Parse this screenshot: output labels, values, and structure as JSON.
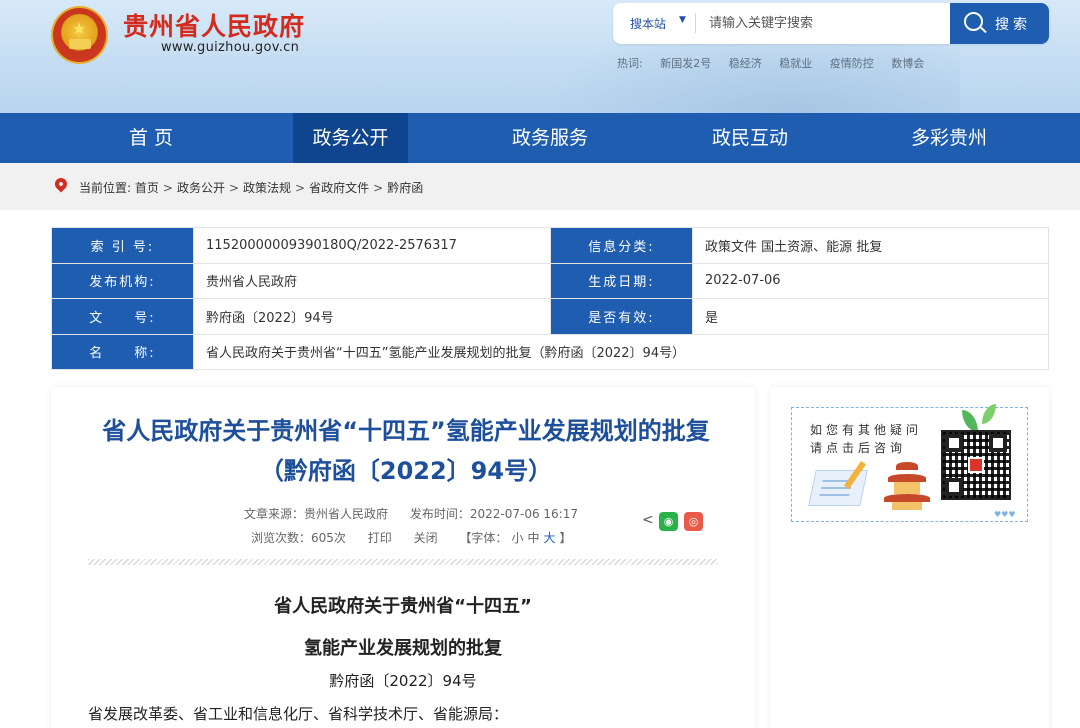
{
  "header": {
    "site_title": "贵州省人民政府",
    "site_url": "www.guizhou.gov.cn",
    "search": {
      "scope": "搜本站",
      "placeholder": "请输入关键字搜索",
      "button_label": "搜索"
    },
    "hot_label": "热词:",
    "hot_words": [
      "新国发2号",
      "稳经济",
      "稳就业",
      "疫情防控",
      "数博会"
    ]
  },
  "nav": {
    "items": [
      {
        "label": "首 页",
        "active": false
      },
      {
        "label": "政务公开",
        "active": true
      },
      {
        "label": "政务服务",
        "active": false
      },
      {
        "label": "政民互动",
        "active": false
      },
      {
        "label": "多彩贵州",
        "active": false
      }
    ]
  },
  "breadcrumb": {
    "prefix": "当前位置:",
    "items": [
      "首页",
      "政务公开",
      "政策法规",
      "省政府文件",
      "黔府函"
    ]
  },
  "info": {
    "index_label": "索 引 号:",
    "index_value": "11520000009390180Q/2022-2576317",
    "category_label": "信息分类:",
    "category_value": "政策文件    国土资源、能源    批复",
    "issuer_label": "发布机构:",
    "issuer_value": "贵州省人民政府",
    "date_label": "生成日期:",
    "date_value": "2022-07-06",
    "docno_label": "文　　号:",
    "docno_value": "黔府函〔2022〕94号",
    "valid_label": "是否有效:",
    "valid_value": "是",
    "name_label": "名　　称:",
    "name_value": "省人民政府关于贵州省“十四五”氢能产业发展规划的批复（黔府函〔2022〕94号）"
  },
  "article": {
    "title": "省人民政府关于贵州省“十四五”氢能产业发展规划的批复（黔府函〔2022〕94号）",
    "source": "文章来源：贵州省人民政府",
    "published": "发布时间：2022-07-06 16:17",
    "views": "浏览次数：605次",
    "print": "打印",
    "close": "关闭",
    "font_prefix": "【字体：",
    "font_small": "小",
    "font_medium": "中",
    "font_large": "大",
    "font_suffix": "】",
    "doc_heading_1": "省人民政府关于贵州省“十四五”",
    "doc_heading_2": "氢能产业发展规划的批复",
    "doc_number": "黔府函〔2022〕94号",
    "addressees": "省发展改革委、省工业和信息化厅、省科学技术厅、省能源局："
  },
  "side": {
    "line1": "如您有其他疑问",
    "line2": "请点击后咨询",
    "hearts": "♥♥♥"
  }
}
